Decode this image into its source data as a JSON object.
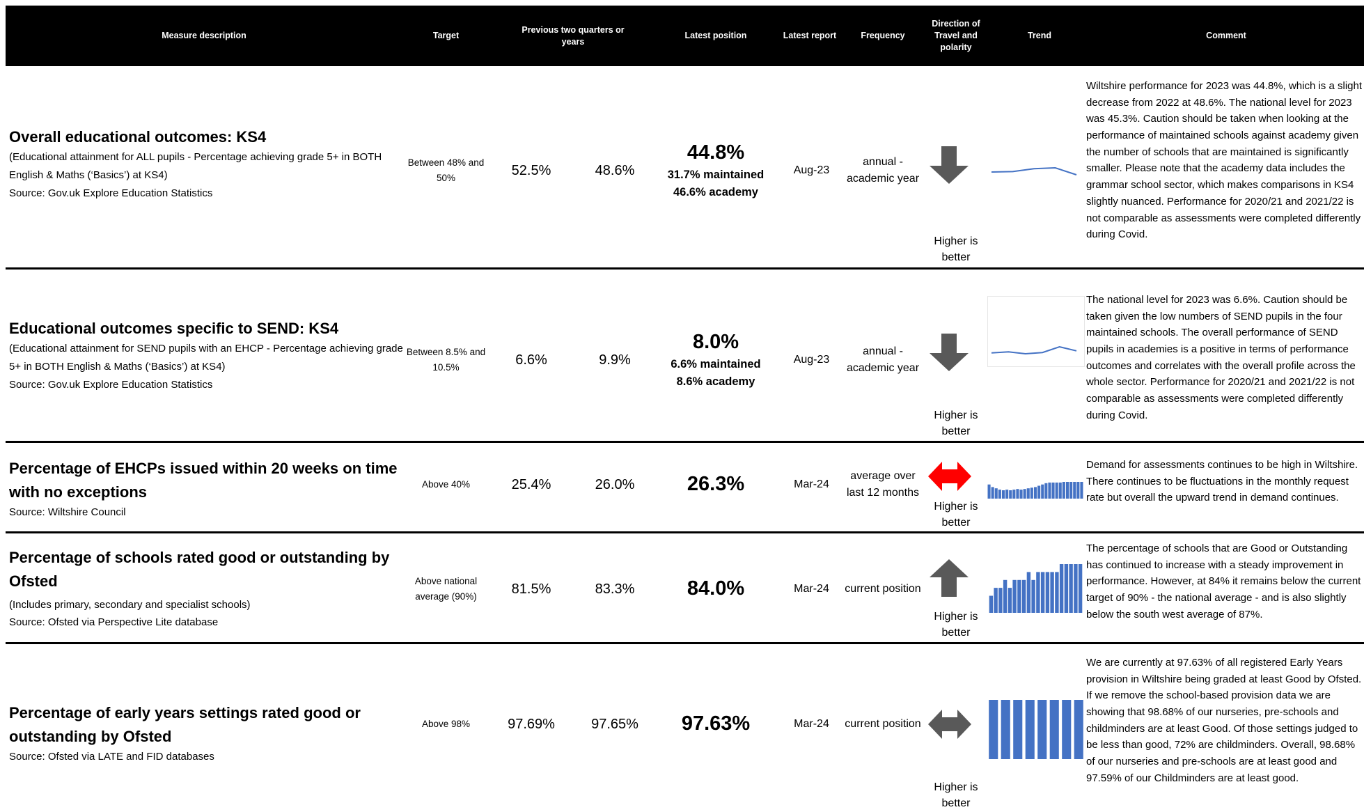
{
  "header": {
    "measure": "Measure description",
    "target": "Target",
    "previous": "Previous two quarters or years",
    "latest": "Latest position",
    "latest_report": "Latest report",
    "frequency": "Frequency",
    "direction": "Direction of Travel and polarity",
    "trend": "Trend",
    "comment": "Comment"
  },
  "colors": {
    "header_bg": "#000000",
    "trend_blue": "#4472C4",
    "arrow_grey": "#595959",
    "arrow_red": "#FF0000"
  },
  "rows": [
    {
      "title": "Overall educational outcomes: KS4",
      "subtitle": "(Educational attainment for ALL pupils - Percentage achieving grade 5+ in BOTH English & Maths (‘Basics’) at KS4)",
      "source": "Source: Gov.uk Explore Education Statistics",
      "target": "Between 48% and 50%",
      "prev1": "52.5%",
      "prev2": "48.6%",
      "latest": "44.8%",
      "latest_sub1": "31.7% maintained",
      "latest_sub2": "46.6% academy",
      "latest_report": "Aug-23",
      "frequency": "annual - academic year",
      "direction": "down",
      "direction_icon": "arrow-down-icon",
      "polarity": "Higher is better",
      "trend_type": "line",
      "trend_values": [
        52.0,
        52.5,
        56.0,
        57.0,
        48.6
      ],
      "comment": "Wiltshire performance for 2023 was 44.8%, which is a slight decrease from 2022 at 48.6%. The national level for 2023 was 45.3%. Caution should be taken when looking at the performance of maintained schools against academy given the number of schools that are maintained is significantly smaller. Please note that the academy data includes the grammar school sector, which makes comparisons in KS4 slightly nuanced. Performance for 2020/21 and 2021/22 is not comparable as assessments were completed differently during Covid."
    },
    {
      "title": "Educational outcomes specific to SEND: KS4",
      "subtitle": "(Educational attainment for SEND pupils with an EHCP - Percentage achieving grade 5+ in BOTH English & Maths (‘Basics’) at KS4)",
      "source": "Source: Gov.uk Explore Education Statistics",
      "target": "Between 8.5% and 10.5%",
      "prev1": "6.6%",
      "prev2": "9.9%",
      "latest": "8.0%",
      "latest_sub1": "6.6% maintained",
      "latest_sub2": "8.6% academy",
      "latest_report": "Aug-23",
      "frequency": "annual - academic year",
      "direction": "down",
      "direction_icon": "arrow-down-icon",
      "polarity": "Higher is better",
      "trend_type": "line",
      "trend_values": [
        7.0,
        7.5,
        6.6,
        7.2,
        9.9,
        8.0
      ],
      "comment": "The national level for 2023 was 6.6%. Caution should be taken given the low numbers of SEND pupils in the four maintained schools. The overall performance of SEND pupils in academies is a positive in terms of performance outcomes and correlates with the overall profile across the whole sector. Performance for 2020/21 and 2021/22 is not comparable as assessments were completed differently during Covid."
    },
    {
      "title": "Percentage of EHCPs issued within 20 weeks on time with no exceptions",
      "subtitle": "",
      "source": "Source: Wiltshire Council",
      "target": "Above 40%",
      "prev1": "25.4%",
      "prev2": "26.0%",
      "latest": "26.3%",
      "latest_sub1": "",
      "latest_sub2": "",
      "latest_report": "Mar-24",
      "frequency": "average over last 12 months",
      "direction": "both",
      "direction_icon": "arrow-left-right-red-icon",
      "polarity": "Higher is better",
      "trend_type": "bar",
      "trend_values": [
        22,
        18,
        16,
        14,
        13,
        14,
        13,
        14,
        15,
        14,
        15,
        16,
        17,
        18,
        20,
        22,
        24,
        25,
        25,
        25,
        25,
        26,
        26,
        26,
        26,
        26,
        26
      ],
      "comment": "Demand for assessments continues to be high in Wiltshire. There continues to be fluctuations in the monthly request rate but overall the upward trend in demand continues."
    },
    {
      "title": "Percentage of schools rated good or outstanding by Ofsted",
      "subtitle": "(Includes primary, secondary and specialist schools)",
      "source": "Source: Ofsted via Perspective Lite database",
      "target": "Above national average (90%)",
      "prev1": "81.5%",
      "prev2": "83.3%",
      "latest": "84.0%",
      "latest_sub1": "",
      "latest_sub2": "",
      "latest_report": "Mar-24",
      "frequency": "current position",
      "direction": "up",
      "direction_icon": "arrow-up-icon",
      "polarity": "Higher is better",
      "trend_type": "bar",
      "trend_values": [
        80,
        81,
        81,
        82,
        81,
        82,
        82,
        82,
        83,
        82,
        83,
        83,
        83,
        83,
        83,
        84,
        84,
        84,
        84,
        84
      ],
      "comment": "The percentage of schools that are Good or Outstanding has continued to increase with a steady improvement in performance. However, at 84% it remains below the current target of 90% - the national average - and is also slightly below the south west average of 87%."
    },
    {
      "title": "Percentage of early years settings rated good or outstanding by Ofsted",
      "subtitle": "",
      "source": "Source: Ofsted via LATE and FID databases",
      "target": "Above 98%",
      "prev1": "97.69%",
      "prev2": "97.65%",
      "latest": "97.63%",
      "latest_sub1": "",
      "latest_sub2": "",
      "latest_report": "Mar-24",
      "frequency": "current position",
      "direction": "both",
      "direction_icon": "arrow-left-right-icon",
      "polarity": "Higher is better",
      "trend_type": "bar",
      "trend_values": [
        97.7,
        97.7,
        97.7,
        97.7,
        97.7,
        97.7,
        97.6,
        97.6
      ],
      "comment": "We are currently at 97.63% of all registered Early Years provision in Wiltshire being graded at least Good by Ofsted. If we remove the school-based provision data we are showing that 98.68% of our nurseries, pre-schools and childminders are at least Good. Of those settings judged to be less than good, 72% are childminders. Overall, 98.68% of our nurseries and pre-schools are at least good and 97.59% of our Childminders are at least good."
    }
  ]
}
